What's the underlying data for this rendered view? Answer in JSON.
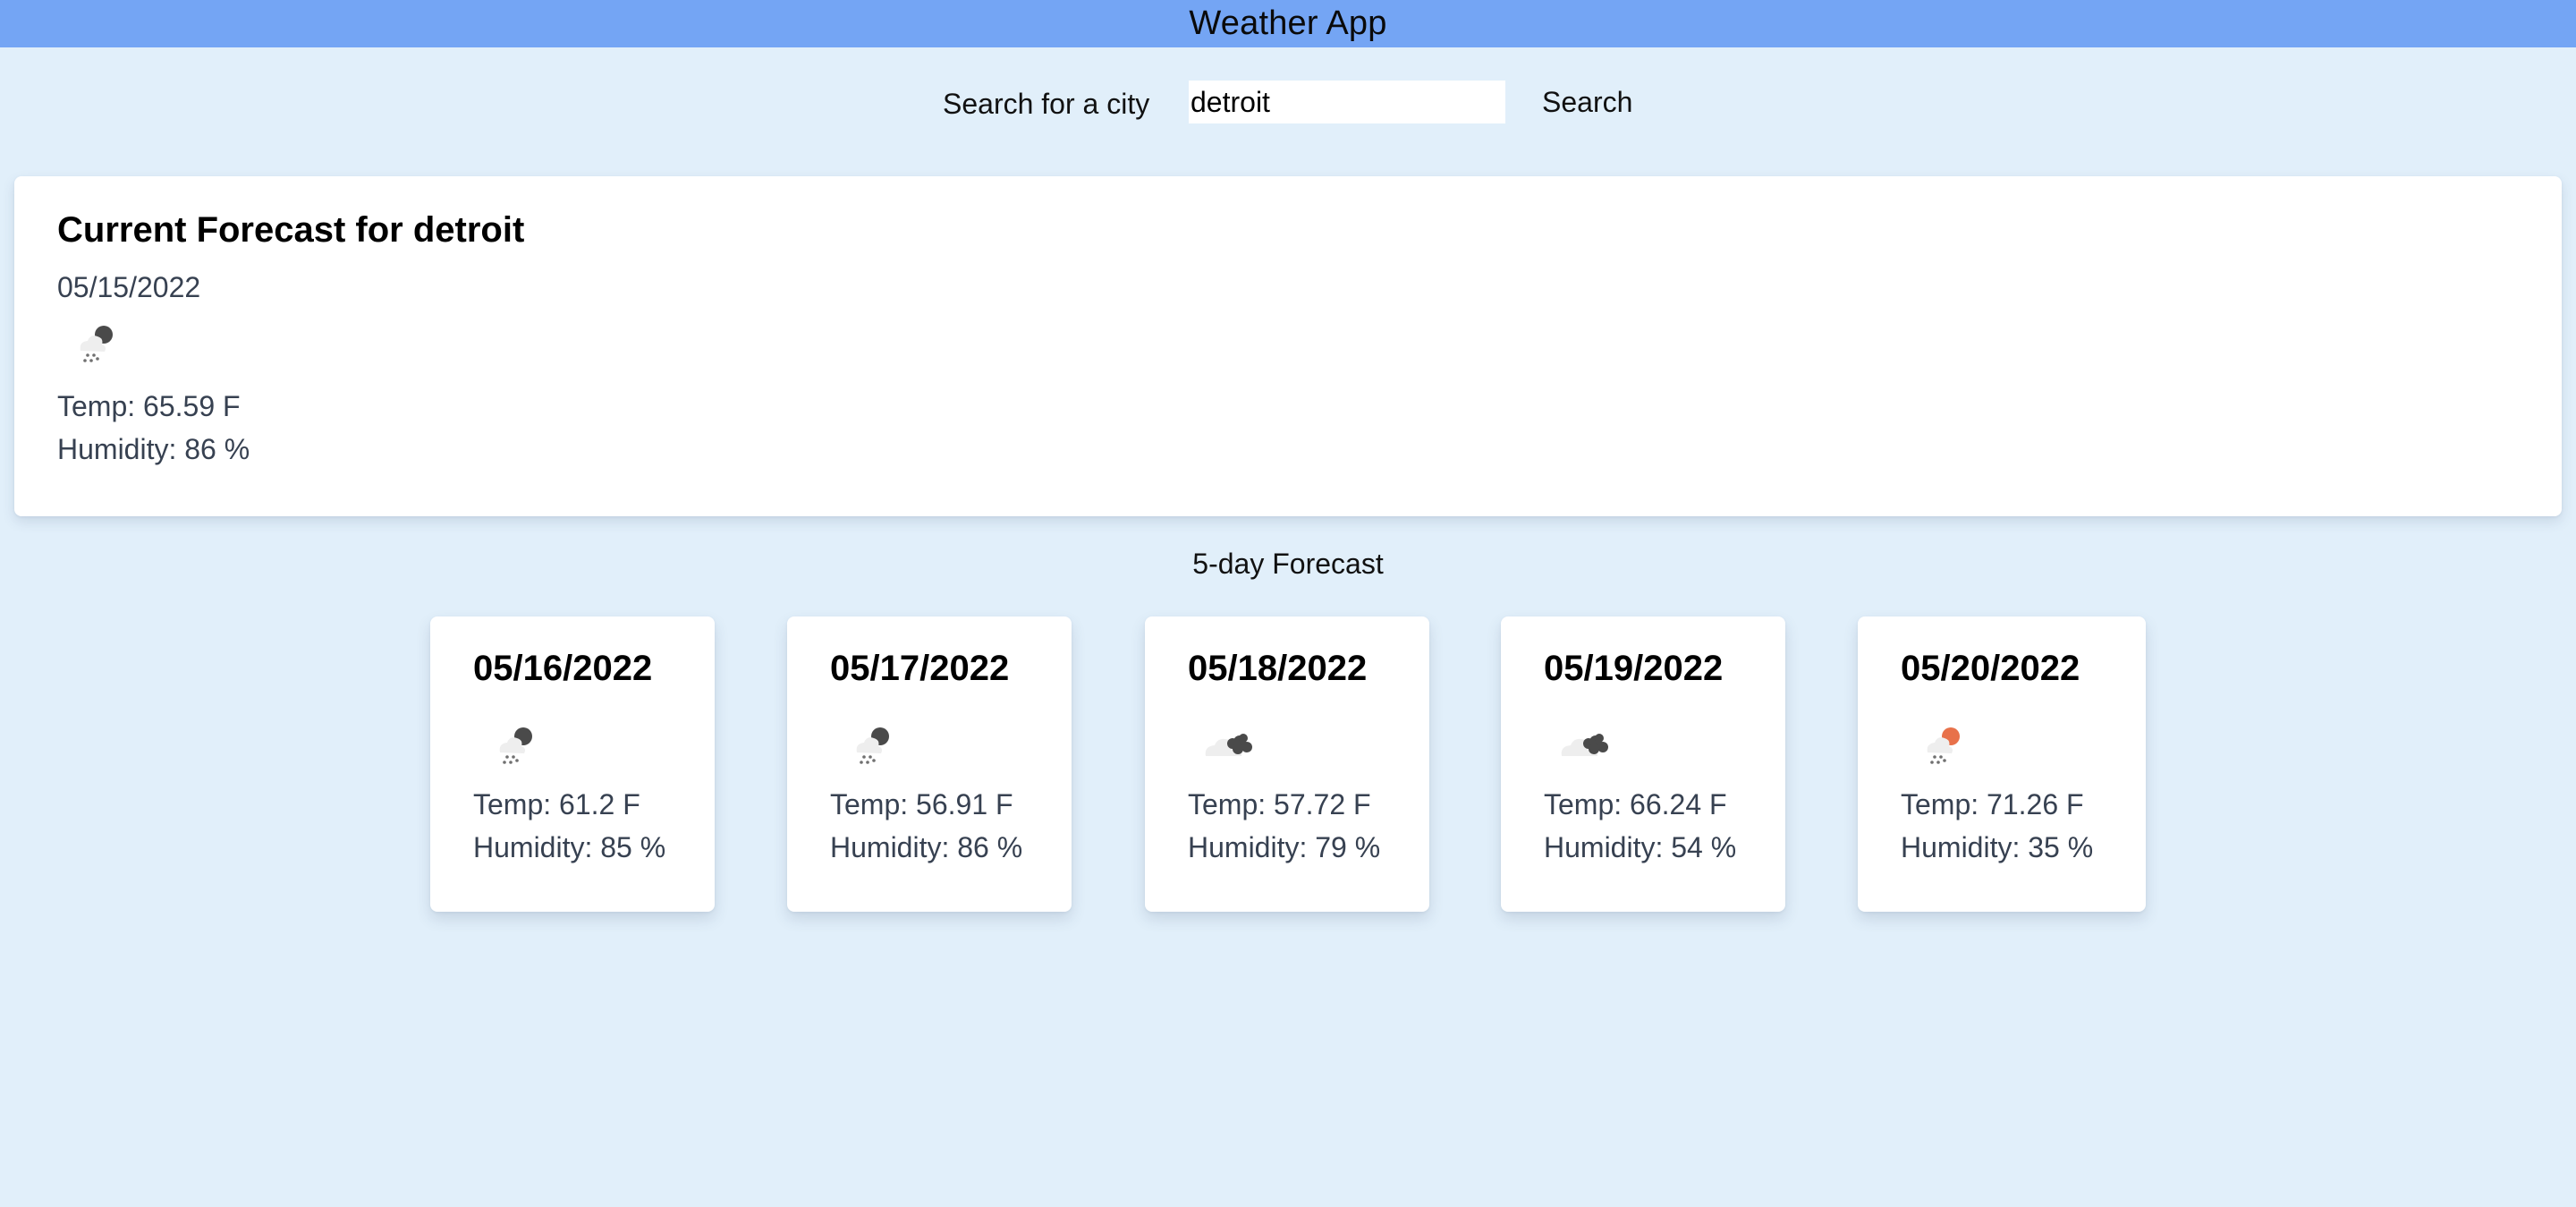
{
  "header": {
    "title": "Weather App"
  },
  "search": {
    "label": "Search for a city",
    "value": "detroit",
    "placeholder": "",
    "button_label": "Search"
  },
  "current": {
    "title": "Current Forecast for detroit",
    "date": "05/15/2022",
    "icon": "rain-night-icon",
    "temp": "Temp: 65.59 F",
    "humidity": "Humidity: 86 %"
  },
  "forecast": {
    "heading": "5-day Forecast",
    "days": [
      {
        "date": "05/16/2022",
        "icon": "rain-night-icon",
        "temp": "Temp: 61.2 F",
        "humidity": "Humidity: 85 %"
      },
      {
        "date": "05/17/2022",
        "icon": "rain-night-icon",
        "temp": "Temp: 56.91 F",
        "humidity": "Humidity: 86 %"
      },
      {
        "date": "05/18/2022",
        "icon": "broken-clouds-icon",
        "temp": "Temp: 57.72 F",
        "humidity": "Humidity: 79 %"
      },
      {
        "date": "05/19/2022",
        "icon": "broken-clouds-icon",
        "temp": "Temp: 66.24 F",
        "humidity": "Humidity: 54 %"
      },
      {
        "date": "05/20/2022",
        "icon": "rain-day-icon",
        "temp": "Temp: 71.26 F",
        "humidity": "Humidity: 35 %"
      }
    ]
  },
  "colors": {
    "header_bg": "#74a5f4",
    "page_bg": "#e1effa",
    "card_bg": "#ffffff",
    "stat_text": "#374151",
    "sun_accent": "#e8714a"
  }
}
